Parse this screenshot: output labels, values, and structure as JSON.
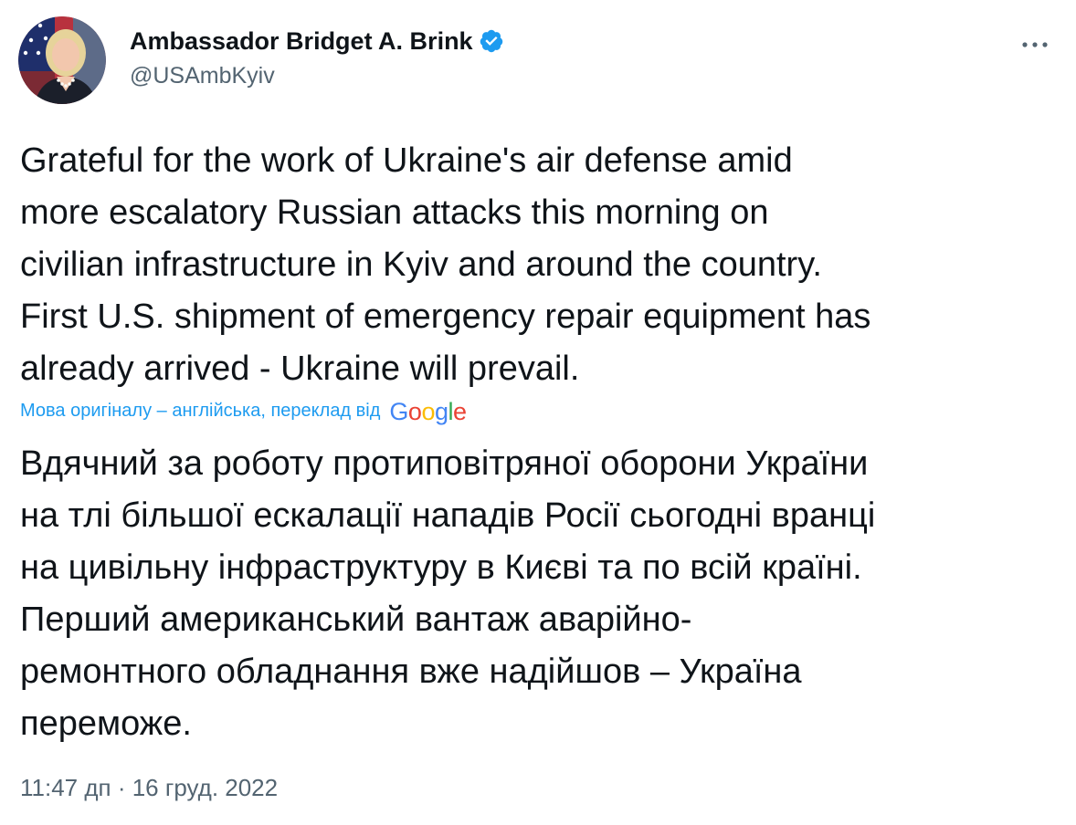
{
  "author": {
    "display_name": "Ambassador Bridget A. Brink",
    "handle": "@USAmbKyiv",
    "verified": true,
    "avatar_icon": "profile-photo"
  },
  "header": {
    "more_icon": "more-horizontal-icon"
  },
  "tweet": {
    "text": "Grateful for the work of Ukraine's air defense amid\nmore escalatory Russian attacks this morning on\ncivilian infrastructure in Kyiv and around the country.\nFirst U.S. shipment of emergency repair equipment has\nalready arrived - Ukraine will prevail.",
    "translation_label": "Мова оригіналу – англійська, переклад від",
    "translation_provider": "Google",
    "translated_text": "Вдячний за роботу протиповітряної оборони України\nна тлі більшої ескалації нападів Росії сьогодні вранці\nна цивільну інфраструктуру в Києві та по всій країні.\nПерший американський вантаж аварійно-\nремонтного обладнання вже надійшов – Україна\nпереможе.",
    "timestamp": "11:47 дп · 16 груд. 2022"
  },
  "colors": {
    "text_primary": "#0f1419",
    "text_secondary": "#536471",
    "accent": "#1d9bf0",
    "google_blue": "#4285f4",
    "google_red": "#ea4335",
    "google_yellow": "#fbbc05",
    "google_green": "#34a853"
  }
}
